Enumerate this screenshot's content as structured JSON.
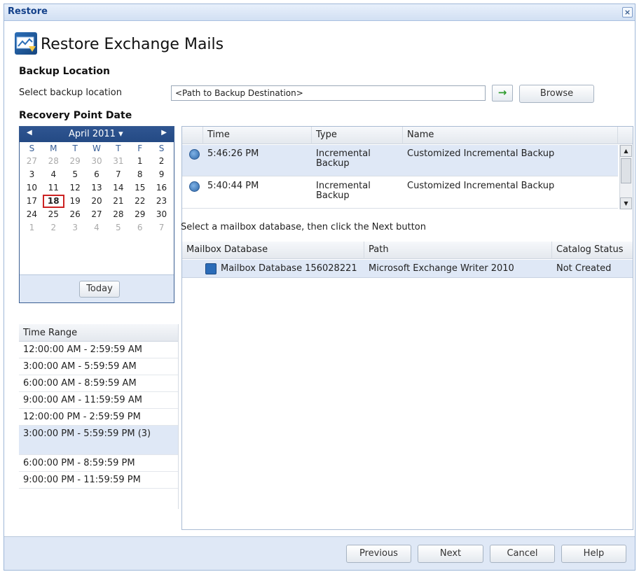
{
  "window": {
    "title": "Restore",
    "close_glyph": "×"
  },
  "header": {
    "title": "Restore Exchange Mails",
    "icon": "restore-exchange-icon"
  },
  "backup_location": {
    "heading": "Backup Location",
    "label": "Select backup location",
    "path_value": "<Path to Backup Destination>",
    "go_glyph": "→",
    "browse_label": "Browse"
  },
  "recovery_point": {
    "heading": "Recovery Point Date",
    "calendar": {
      "month": "April 2011",
      "dropdown_glyph": "▾",
      "prev_glyph": "◀",
      "next_glyph": "▶",
      "weekdays": [
        "S",
        "M",
        "T",
        "W",
        "T",
        "F",
        "S"
      ],
      "weeks": [
        [
          "27",
          "28",
          "29",
          "30",
          "31",
          "1",
          "2"
        ],
        [
          "3",
          "4",
          "5",
          "6",
          "7",
          "8",
          "9"
        ],
        [
          "10",
          "11",
          "12",
          "13",
          "14",
          "15",
          "16"
        ],
        [
          "17",
          "18",
          "19",
          "20",
          "21",
          "22",
          "23"
        ],
        [
          "24",
          "25",
          "26",
          "27",
          "28",
          "29",
          "30"
        ],
        [
          "1",
          "2",
          "3",
          "4",
          "5",
          "6",
          "7"
        ]
      ],
      "selected_day": "18",
      "today_label": "Today"
    }
  },
  "time_range": {
    "header": "Time Range",
    "items": [
      "12:00:00 AM - 2:59:59 AM",
      "3:00:00 AM - 5:59:59 AM",
      "6:00:00 AM - 8:59:59 AM",
      "9:00:00 AM - 11:59:59 AM",
      "12:00:00 PM - 2:59:59 PM",
      "3:00:00 PM - 5:59:59 PM (3)",
      "6:00:00 PM - 8:59:59 PM",
      "9:00:00 PM - 11:59:59 PM"
    ],
    "selected_index": 5
  },
  "recovery_points": {
    "columns": [
      "Time",
      "Type",
      "Name"
    ],
    "rows": [
      {
        "time": "5:46:26 PM",
        "type": "Incremental Backup",
        "name": "Customized Incremental Backup",
        "icon": "backup-clock-icon"
      },
      {
        "time": "5:40:44 PM",
        "type": "Incremental Backup",
        "name": "Customized Incremental Backup",
        "icon": "backup-clock-icon"
      }
    ]
  },
  "instruction": "Select a mailbox database, then click the Next button",
  "mailbox": {
    "columns": [
      "Mailbox Database",
      "Path",
      "Catalog Status"
    ],
    "rows": [
      {
        "database": "Mailbox Database 156028221",
        "path": "Microsoft Exchange Writer 2010",
        "status": "Not Created",
        "icon": "mailbox-database-icon"
      }
    ]
  },
  "footer": {
    "previous_label": "Previous",
    "next_label": "Next",
    "cancel_label": "Cancel",
    "help_label": "Help"
  }
}
